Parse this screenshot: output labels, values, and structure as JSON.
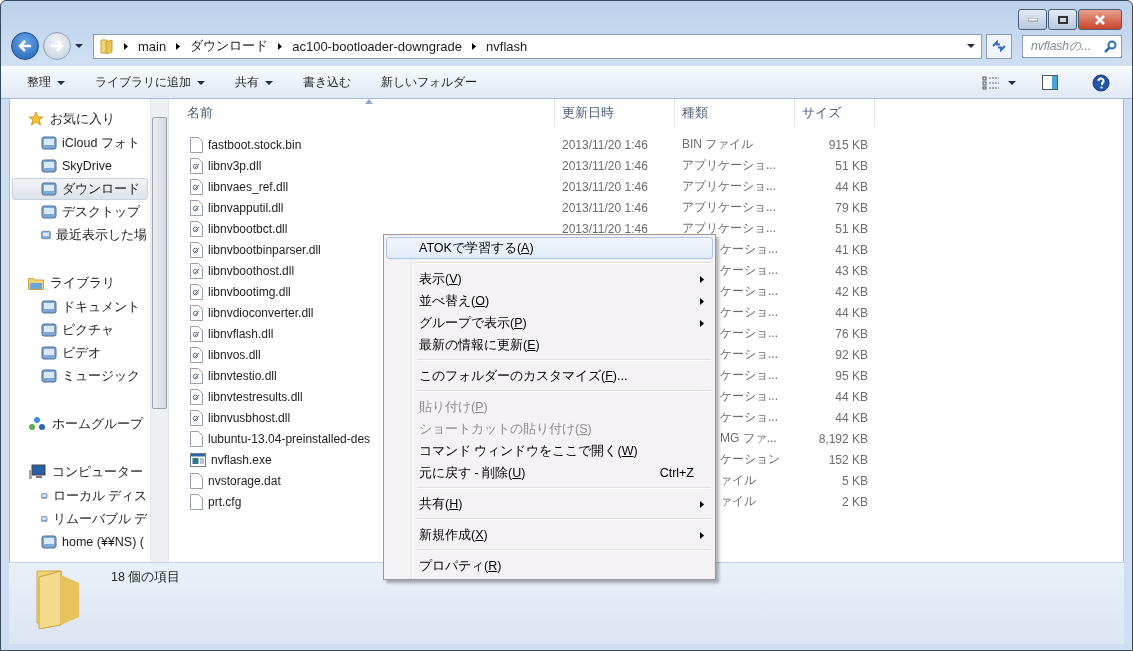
{
  "address_bar": {
    "path": [
      "main",
      "ダウンロード",
      "ac100-bootloader-downgrade",
      "nvflash"
    ]
  },
  "search": {
    "placeholder": "nvflashの..."
  },
  "toolbar": {
    "buttons": [
      {
        "label": "整理",
        "dropdown": true
      },
      {
        "label": "ライブラリに追加",
        "dropdown": true
      },
      {
        "label": "共有",
        "dropdown": true
      },
      {
        "label": "書き込む",
        "dropdown": false
      },
      {
        "label": "新しいフォルダー",
        "dropdown": false
      }
    ]
  },
  "sidebar": {
    "groups": [
      {
        "label": "お気に入り",
        "children": [
          {
            "label": "iCloud フォト",
            "selected": false
          },
          {
            "label": "SkyDrive",
            "selected": false
          },
          {
            "label": "ダウンロード",
            "selected": true
          },
          {
            "label": "デスクトップ",
            "selected": false
          },
          {
            "label": "最近表示した場",
            "selected": false
          }
        ]
      },
      {
        "label": "ライブラリ",
        "children": [
          {
            "label": "ドキュメント",
            "selected": false
          },
          {
            "label": "ピクチャ",
            "selected": false
          },
          {
            "label": "ビデオ",
            "selected": false
          },
          {
            "label": "ミュージック",
            "selected": false
          }
        ]
      },
      {
        "label": "ホームグループ"
      },
      {
        "label": "コンピューター",
        "children": [
          {
            "label": "ローカル ディス",
            "selected": false
          },
          {
            "label": "リムーバブル デ",
            "selected": false
          },
          {
            "label": "home (¥¥NS) (",
            "selected": false
          }
        ]
      }
    ]
  },
  "table": {
    "columns": [
      {
        "label": "名前",
        "sorted": true
      },
      {
        "label": "更新日時",
        "sorted": false
      },
      {
        "label": "種類",
        "sorted": false
      },
      {
        "label": "サイズ",
        "sorted": false
      }
    ],
    "rows": [
      {
        "kind": "file",
        "name": "fastboot.stock.bin",
        "modified": "2013/11/20 1:46",
        "type": "BIN ファイル",
        "size": "915 KB"
      },
      {
        "kind": "dll",
        "name": "libnv3p.dll",
        "modified": "2013/11/20 1:46",
        "type": "アプリケーショ...",
        "size": "51 KB"
      },
      {
        "kind": "dll",
        "name": "libnvaes_ref.dll",
        "modified": "2013/11/20 1:46",
        "type": "アプリケーショ...",
        "size": "44 KB"
      },
      {
        "kind": "dll",
        "name": "libnvapputil.dll",
        "modified": "2013/11/20 1:46",
        "type": "アプリケーショ...",
        "size": "79 KB"
      },
      {
        "kind": "dll",
        "name": "libnvbootbct.dll",
        "modified": "2013/11/20 1:46",
        "type": "アプリケーショ...",
        "size": "51 KB"
      },
      {
        "kind": "dll",
        "name": "libnvbootbinparser.dll",
        "type": "ケーショ...",
        "size": "41 KB"
      },
      {
        "kind": "dll",
        "name": "libnvboothost.dll",
        "type": "ケーショ...",
        "size": "43 KB"
      },
      {
        "kind": "dll",
        "name": "libnvbootimg.dll",
        "type": "ケーショ...",
        "size": "42 KB"
      },
      {
        "kind": "dll",
        "name": "libnvdioconverter.dll",
        "type": "ケーショ...",
        "size": "44 KB"
      },
      {
        "kind": "dll",
        "name": "libnvflash.dll",
        "type": "ケーショ...",
        "size": "76 KB"
      },
      {
        "kind": "dll",
        "name": "libnvos.dll",
        "type": "ケーショ...",
        "size": "92 KB"
      },
      {
        "kind": "dll",
        "name": "libnvtestio.dll",
        "type": "ケーショ...",
        "size": "95 KB"
      },
      {
        "kind": "dll",
        "name": "libnvtestresults.dll",
        "type": "ケーショ...",
        "size": "44 KB"
      },
      {
        "kind": "dll",
        "name": "libnvusbhost.dll",
        "type": "ケーショ...",
        "size": "44 KB"
      },
      {
        "kind": "file",
        "name": "lubuntu-13.04-preinstalled-des",
        "type": "MG ファ...",
        "size": "8,192 KB"
      },
      {
        "kind": "exe",
        "name": "nvflash.exe",
        "type": "ケーション",
        "size": "152 KB"
      },
      {
        "kind": "file",
        "name": "nvstorage.dat",
        "type": "ァイル",
        "size": "5 KB"
      },
      {
        "kind": "file",
        "name": "prt.cfg",
        "type": "ァイル",
        "size": "2 KB"
      }
    ]
  },
  "context_menu": {
    "groups": [
      [
        {
          "before": "ATOKで学習する(",
          "accel": "A",
          "after": ")",
          "selected": true,
          "disabled": false,
          "submenu": false
        }
      ],
      [
        {
          "before": "表示(",
          "accel": "V",
          "after": ")",
          "selected": false,
          "disabled": false,
          "submenu": true
        },
        {
          "before": "並べ替え(",
          "accel": "O",
          "after": ")",
          "selected": false,
          "disabled": false,
          "submenu": true
        },
        {
          "before": "グループで表示(",
          "accel": "P",
          "after": ")",
          "selected": false,
          "disabled": false,
          "submenu": true
        },
        {
          "before": "最新の情報に更新(",
          "accel": "E",
          "after": ")",
          "selected": false,
          "disabled": false,
          "submenu": false
        }
      ],
      [
        {
          "before": "このフォルダーのカスタマイズ(",
          "accel": "F",
          "after": ")...",
          "selected": false,
          "disabled": false,
          "submenu": false
        }
      ],
      [
        {
          "before": "貼り付け(",
          "accel": "P",
          "after": ")",
          "selected": false,
          "disabled": true,
          "submenu": false
        },
        {
          "before": "ショートカットの貼り付け(",
          "accel": "S",
          "after": ")",
          "selected": false,
          "disabled": true,
          "submenu": false
        },
        {
          "before": "コマンド ウィンドウをここで開く(",
          "accel": "W",
          "after": ")",
          "selected": false,
          "disabled": false,
          "submenu": false
        },
        {
          "before": "元に戻す - 削除(",
          "accel": "U",
          "after": ")",
          "shortcut": "Ctrl+Z",
          "selected": false,
          "disabled": false,
          "submenu": false
        }
      ],
      [
        {
          "before": "共有(",
          "accel": "H",
          "after": ")",
          "selected": false,
          "disabled": false,
          "submenu": true
        }
      ],
      [
        {
          "before": "新規作成(",
          "accel": "X",
          "after": ")",
          "selected": false,
          "disabled": false,
          "submenu": true
        }
      ],
      [
        {
          "before": "プロパティ(",
          "accel": "R",
          "after": ")",
          "selected": false,
          "disabled": false,
          "submenu": false
        }
      ]
    ]
  },
  "status_bar": {
    "text": "18 個の項目"
  }
}
